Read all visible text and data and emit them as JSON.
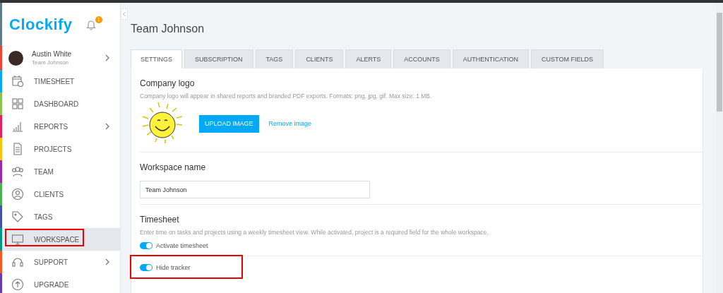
{
  "sidebar": {
    "logo": "Clockify",
    "notification_count": "1",
    "user": {
      "name": "Austin White",
      "team": "Team Johnson",
      "color": "#f44336"
    },
    "items": [
      {
        "label": "TIMESHEET",
        "kind": "calendar",
        "color": "#03a9f4",
        "selected": false,
        "expandable": false,
        "highlighted": false
      },
      {
        "label": "DASHBOARD",
        "kind": "grid",
        "color": "#8bc34a",
        "selected": false,
        "expandable": false,
        "highlighted": false
      },
      {
        "label": "REPORTS",
        "kind": "bars",
        "color": "#e91e63",
        "selected": false,
        "expandable": true,
        "highlighted": false
      },
      {
        "label": "PROJECTS",
        "kind": "doc",
        "color": "#ffc107",
        "selected": false,
        "expandable": false,
        "highlighted": false
      },
      {
        "label": "TEAM",
        "kind": "people",
        "color": "#9c27b0",
        "selected": false,
        "expandable": false,
        "highlighted": false
      },
      {
        "label": "CLIENTS",
        "kind": "person",
        "color": "#4caf50",
        "selected": false,
        "expandable": false,
        "highlighted": false
      },
      {
        "label": "TAGS",
        "kind": "tag",
        "color": "#3f51b5",
        "selected": false,
        "expandable": false,
        "highlighted": false
      },
      {
        "label": "WORKSPACE",
        "kind": "monitor",
        "color": "#009688",
        "selected": true,
        "expandable": false,
        "highlighted": true
      },
      {
        "label": "SUPPORT",
        "kind": "headset",
        "color": "#ff5722",
        "selected": false,
        "expandable": true,
        "highlighted": false
      },
      {
        "label": "UPGRADE",
        "kind": "upload",
        "color": "#673ab7",
        "selected": false,
        "expandable": false,
        "highlighted": false
      }
    ]
  },
  "page_title": "Team Johnson",
  "tabs": [
    {
      "label": "SETTINGS",
      "selected": true
    },
    {
      "label": "SUBSCRIPTION",
      "selected": false
    },
    {
      "label": "TAGS",
      "selected": false
    },
    {
      "label": "CLIENTS",
      "selected": false
    },
    {
      "label": "ALERTS",
      "selected": false
    },
    {
      "label": "ACCOUNTS",
      "selected": false
    },
    {
      "label": "AUTHENTICATION",
      "selected": false
    },
    {
      "label": "CUSTOM FIELDS",
      "selected": false
    }
  ],
  "company_logo": {
    "heading": "Company logo",
    "description": "Company logo will appear in shared reports and branded PDF exports. Formats: png, jpg, gif. Max size: 1 MB.",
    "upload_button": "UPLOAD IMAGE",
    "remove_link": "Remove image"
  },
  "workspace_name": {
    "heading": "Workspace name",
    "value": "Team Johnson"
  },
  "timesheet": {
    "heading": "Timesheet",
    "description": "Enter time on tasks and projects using a weekly timesheet view. While activated, project is a required field for the whole workspace.",
    "toggles": [
      {
        "label": "Activate timesheet",
        "on": true,
        "highlighted": false
      },
      {
        "label": "Hide tracker",
        "on": true,
        "highlighted": true
      }
    ]
  }
}
